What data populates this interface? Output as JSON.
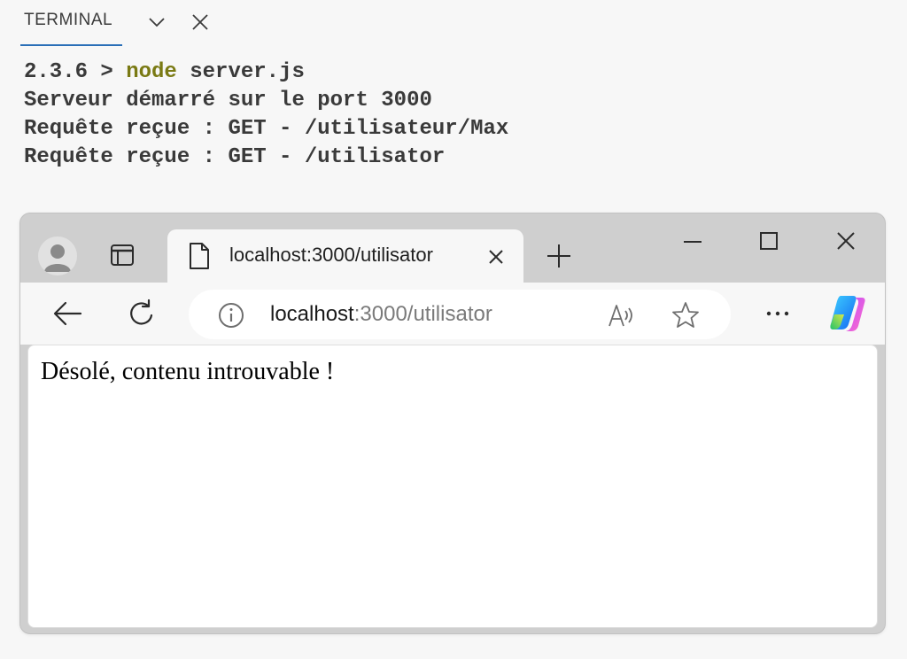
{
  "terminal": {
    "tab_label": "TERMINAL",
    "prompt": "2.3.6 > ",
    "command_node": "node",
    "command_args": " server.js",
    "lines": [
      "Serveur démarré sur le port 3000",
      "Requête reçue : GET - /utilisateur/Max",
      "Requête reçue : GET - /utilisator"
    ],
    "icons": {
      "dropdown": "chevron-down-icon",
      "close": "close-icon"
    }
  },
  "browser": {
    "tab": {
      "title": "localhost:3000/utilisator"
    },
    "address": {
      "host": "localhost",
      "rest": ":3000/utilisator"
    },
    "page": {
      "message": "Désolé, contenu introuvable !"
    },
    "icons": [
      "profile-icon",
      "tab-actions-icon",
      "page-icon",
      "close-icon",
      "plus-icon",
      "minimize-icon",
      "maximize-icon",
      "back-icon",
      "refresh-icon",
      "info-icon",
      "read-aloud-icon",
      "favorite-star-icon",
      "more-icon",
      "copilot-icon"
    ]
  },
  "colors": {
    "terminal_text": "#3a3a3a",
    "node_keyword": "#7a7a14",
    "tab_underline": "#2a6fb7",
    "url_secondary": "#7a7a7a"
  }
}
